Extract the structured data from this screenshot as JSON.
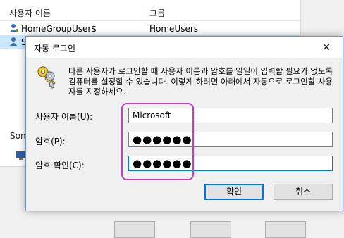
{
  "background": {
    "columns": [
      "사용자 이름",
      "그룹"
    ],
    "rows": [
      {
        "name": "HomeGroupUser$",
        "group": "HomeUsers",
        "selected": false
      },
      {
        "name": "S",
        "group": "",
        "selected": true
      }
    ],
    "group_label": "Son"
  },
  "dialog": {
    "title": "자동 로그인",
    "close_glyph": "✕",
    "description": "다른 사용자가 로그인할 때 사용자 이름과 암호를 일일이 입력할 필요가 없도록 컴퓨터를 설정할 수 있습니다. 이렇게 하려면 아래에서 자동으로 로그인할 사용자를 지정하세요.",
    "fields": {
      "username": {
        "label": "사용자 이름(U):",
        "value": "Microsoft"
      },
      "password": {
        "label": "암호(P):",
        "value": "●●●●●●"
      },
      "confirm": {
        "label": "암호 확인(C):",
        "value": "●●●●●●"
      }
    },
    "buttons": {
      "ok": "확인",
      "cancel": "취소"
    },
    "icon": "keys-icon"
  },
  "colors": {
    "accent": "#0078d7",
    "annotation": "#c43bc4",
    "selection": "#cce8ff"
  }
}
